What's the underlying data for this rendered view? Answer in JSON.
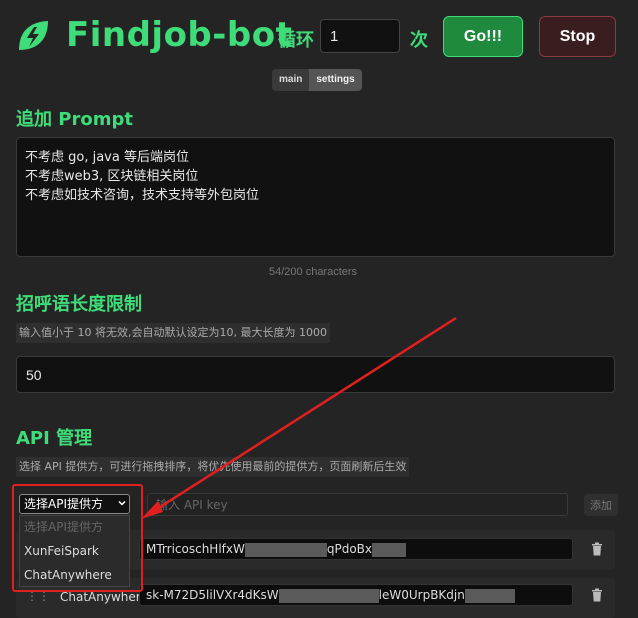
{
  "header": {
    "brand": "Findjob-bot",
    "loop_label": "循环",
    "count_value": "1",
    "times_label": "次",
    "go_label": "Go!!!",
    "stop_label": "Stop"
  },
  "tabs": [
    {
      "label": "main",
      "active": false
    },
    {
      "label": "settings",
      "active": true
    }
  ],
  "prompt_section": {
    "title": "追加 Prompt",
    "lines": [
      "不考虑 go, java 等后端岗位",
      "不考虑web3, 区块链相关岗位",
      "不考虑如技术咨询，技术支持等外包岗位"
    ],
    "char_count": "54/200 characters"
  },
  "greeting_section": {
    "title": "招呼语长度限制",
    "hint": "输入值小于 10 将无效,会自动默认设定为10, 最大长度为 1000",
    "value": "50"
  },
  "api_section": {
    "title": "API 管理",
    "hint": "选择 API 提供方，可进行拖拽排序，将优先使用最前的提供方，页面刷新后生效",
    "select_value": "选择API提供方",
    "key_placeholder": "输入 API key",
    "add_label": "添加",
    "dropdown_options": [
      "选择API提供方",
      "XunFeiSpark",
      "ChatAnywhere"
    ],
    "rows": [
      {
        "name": "",
        "key_prefix": "MTrricoschHlfxW",
        "key_suffix": "qPdoBx"
      },
      {
        "name": "ChatAnywhere",
        "key_prefix": "sk-M72D5lilVXr4dKsW",
        "key_suffix": "leW0UrpBKdjn"
      }
    ]
  },
  "colors": {
    "accent": "#3fdc7a",
    "background": "#242424",
    "highlight": "#e02020"
  }
}
